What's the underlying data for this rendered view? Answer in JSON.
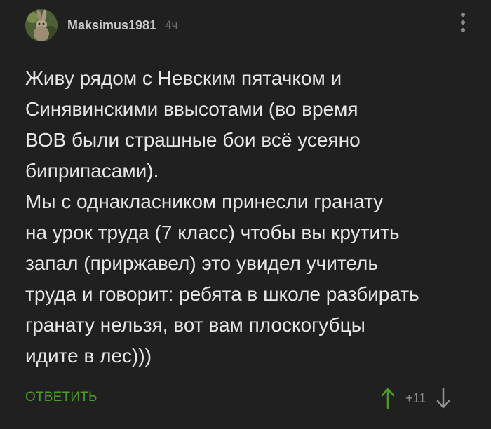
{
  "comment": {
    "author": "Maksimus1981",
    "time": "4ч",
    "text": "Живу рядом с Невским пятачком и\nСинявинскими ввысотами (во время\nВОВ были страшные бои всё усеяно\nбиприпасами).\nМы с однакласником принесли гранату\nна урок труда (7 класс) чтобы вы крутить\nзапал (прир­жавел) это увидел учитель\nтруда и говорит: ребята в школе разбирать\nгранату нельзя, вот вам плоскогубцы\nидите в лес)))",
    "reply_label": "ОТВЕТИТЬ",
    "score": "+11"
  },
  "icons": {
    "avatar": "hare-avatar",
    "menu": "more-vertical-icon",
    "upvote": "arrow-up-icon",
    "downvote": "arrow-down-icon"
  },
  "colors": {
    "background": "#202020",
    "accent": "#4e9a27",
    "text": "#e6e6e6",
    "muted": "#8f8f8f"
  }
}
